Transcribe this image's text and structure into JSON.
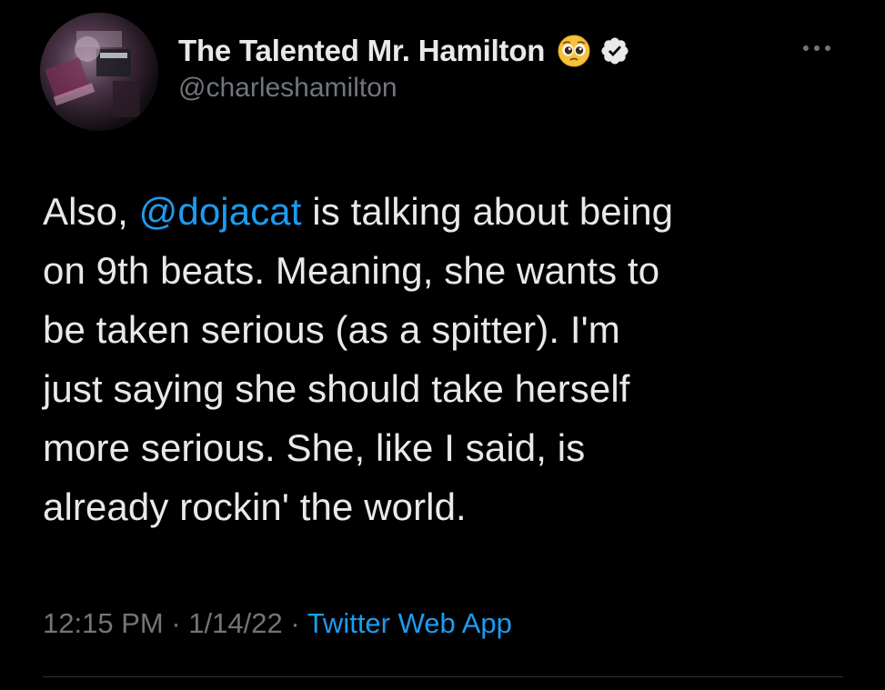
{
  "author": {
    "display_name": "The Talented Mr. Hamilton",
    "handle": "@charleshamilton",
    "name_emoji": "pleading-face-emoji",
    "verified_icon": "verified-badge-icon",
    "avatar_icon": "profile-avatar"
  },
  "tweet": {
    "lines": [
      {
        "before": "Also, ",
        "mention": "@dojacat",
        "after": " is talking about being"
      },
      {
        "text": "on 9th beats. Meaning, she wants to"
      },
      {
        "text": "be taken serious (as a spitter). I'm"
      },
      {
        "text": "just saying she should take herself"
      },
      {
        "text": "more serious. She, like I said, is"
      },
      {
        "text": "already rockin' the world."
      }
    ]
  },
  "meta": {
    "time": "12:15 PM",
    "sep1": " · ",
    "date": "1/14/22",
    "sep2": " · ",
    "source": "Twitter Web App"
  },
  "more_icon": "more-options-icon",
  "colors": {
    "background": "#000000",
    "text": "#e7e9ea",
    "secondary": "#71767b",
    "link": "#1d9bf0",
    "divider": "#2f3336"
  }
}
